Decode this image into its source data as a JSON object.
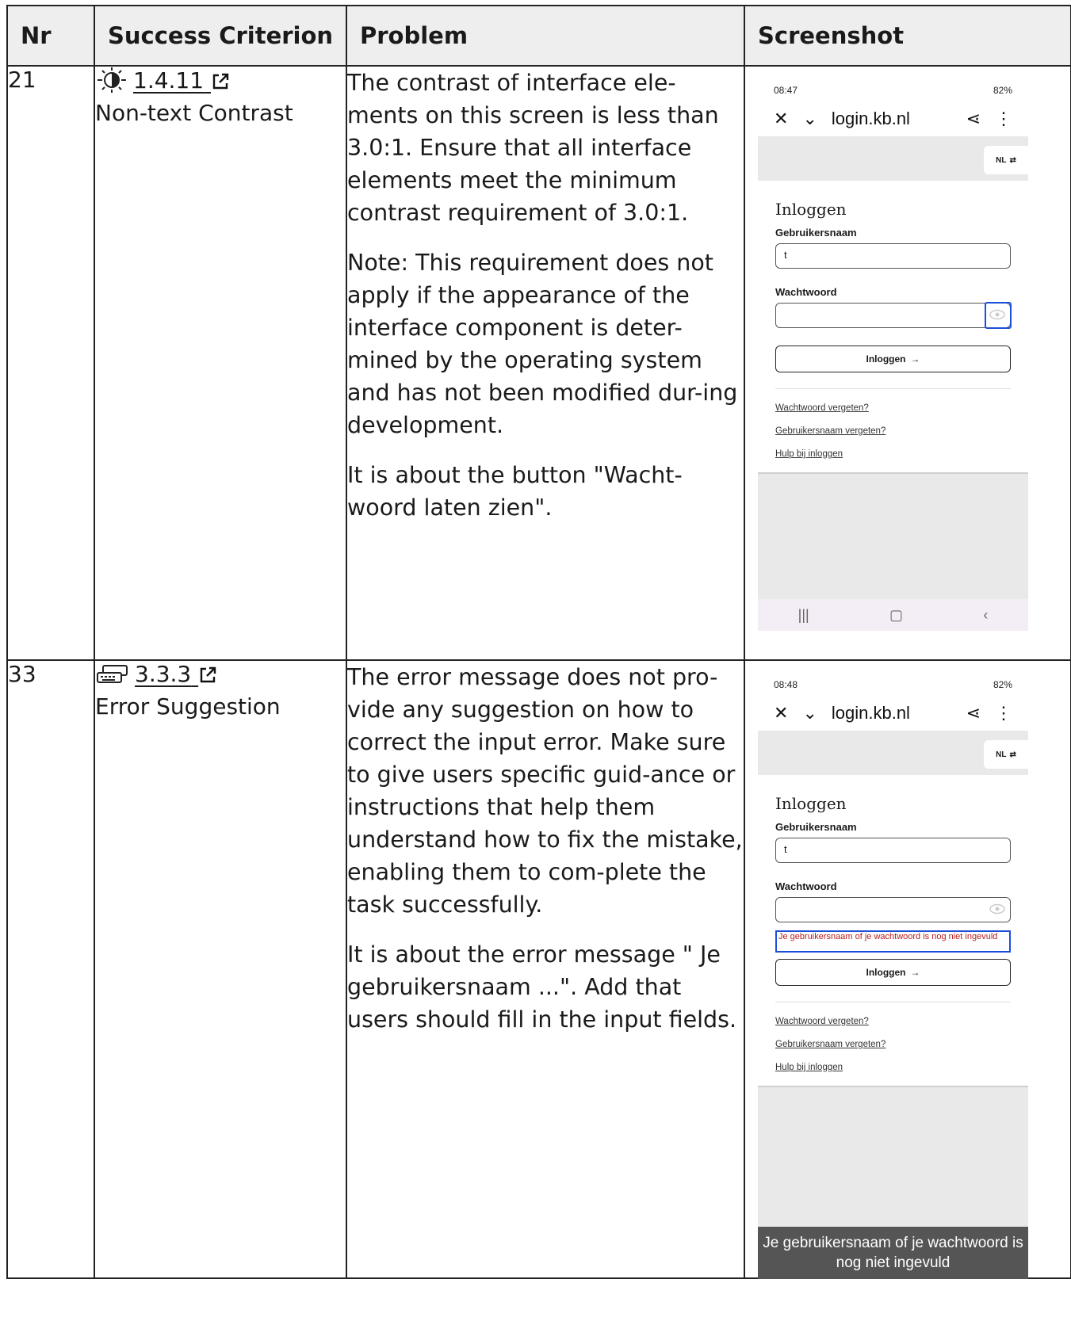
{
  "headers": {
    "nr": "Nr",
    "criterion": "Success Criterion",
    "problem": "Problem",
    "screenshot": "Screenshot"
  },
  "rows": [
    {
      "nr": "21",
      "criterion_code": "1.4.11",
      "criterion_name": "Non-text Contrast",
      "criterion_icon": "contrast-icon",
      "problem_paragraphs": [
        "The contrast of interface ele-ments on this screen is less than 3.0:1. Ensure that all interface elements meet the minimum contrast requirement of 3.0:1.",
        "Note: This requirement does not apply if the appearance of the interface component is deter-mined by the operating system and has not been modified dur-ing development.",
        "It is about the button \"Wacht-woord laten zien\"."
      ],
      "phone": {
        "time": "08:47",
        "battery": "82%",
        "url": "login.kb.nl",
        "lang": "NL",
        "heading": "Inloggen",
        "username_label": "Gebruikersnaam",
        "username_value": "t",
        "password_label": "Wachtwoord",
        "login_button": "Inloggen",
        "links": [
          "Wachtwoord vergeten?",
          "Gebruikersnaam vergeten?",
          "Hulp bij inloggen"
        ]
      }
    },
    {
      "nr": "33",
      "criterion_code": "3.3.3",
      "criterion_name": "Error Suggestion",
      "criterion_icon": "keyboard-icon",
      "problem_paragraphs": [
        "The error message does not pro-vide any suggestion on how to correct the input error. Make sure to give users specific guid-ance or instructions that help them understand how to fix the mistake, enabling them to com-plete the task successfully.",
        "It is about the error message \" Je gebruikersnaam ...\". Add that users should fill in the input fields."
      ],
      "phone": {
        "time": "08:48",
        "battery": "82%",
        "url": "login.kb.nl",
        "lang": "NL",
        "heading": "Inloggen",
        "username_label": "Gebruikersnaam",
        "username_value": "t",
        "password_label": "Wachtwoord",
        "error_message": "Je gebruikersnaam of je wachtwoord is nog niet ingevuld",
        "login_button": "Inloggen",
        "links": [
          "Wachtwoord vergeten?",
          "Gebruikersnaam vergeten?",
          "Hulp bij inloggen"
        ],
        "toast": "Je gebruikersnaam of je wachtwoord is nog niet ingevuld"
      }
    }
  ]
}
